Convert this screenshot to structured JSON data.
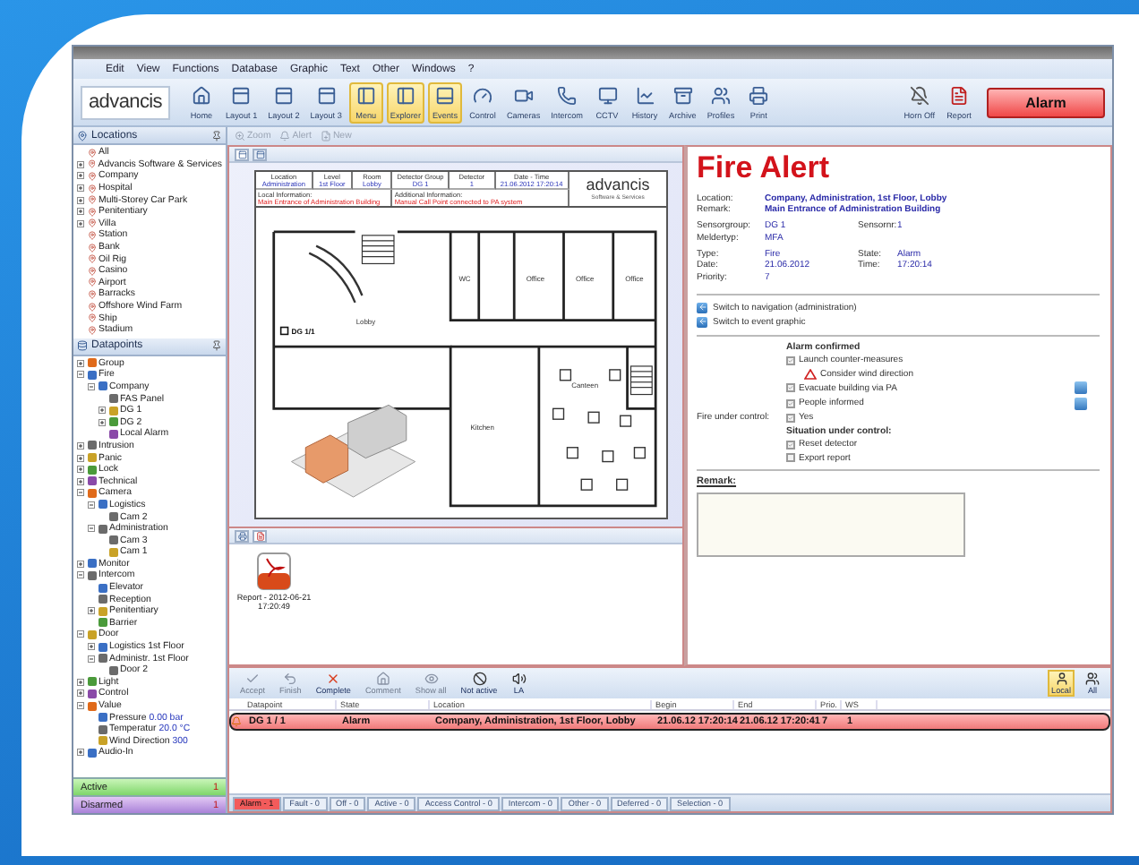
{
  "menu": [
    "Edit",
    "View",
    "Functions",
    "Database",
    "Graphic",
    "Text",
    "Other",
    "Windows",
    "?"
  ],
  "logo": "advancis",
  "ribbon": {
    "buttons": [
      {
        "label": "Home",
        "selected": false
      },
      {
        "label": "Layout 1",
        "selected": false
      },
      {
        "label": "Layout 2",
        "selected": false
      },
      {
        "label": "Layout 3",
        "selected": false
      },
      {
        "label": "Menu",
        "selected": true
      },
      {
        "label": "Explorer",
        "selected": true
      },
      {
        "label": "Events",
        "selected": true
      },
      {
        "label": "Control",
        "selected": false
      },
      {
        "label": "Cameras",
        "selected": false
      },
      {
        "label": "Intercom",
        "selected": false
      },
      {
        "label": "CCTV",
        "selected": false
      },
      {
        "label": "History",
        "selected": false
      },
      {
        "label": "Archive",
        "selected": false
      },
      {
        "label": "Profiles",
        "selected": false
      },
      {
        "label": "Print",
        "selected": false
      }
    ],
    "right_buttons": [
      "Horn Off",
      "Report"
    ],
    "alarm": "Alarm"
  },
  "locations": {
    "title": "Locations",
    "items": [
      {
        "label": "All"
      },
      {
        "label": "Advancis Software & Services",
        "expanded": false
      },
      {
        "label": "Company",
        "expanded": false
      },
      {
        "label": "Hospital",
        "expanded": false
      },
      {
        "label": "Multi-Storey Car Park",
        "expanded": false
      },
      {
        "label": "Penitentiary",
        "expanded": false
      },
      {
        "label": "Villa",
        "expanded": false
      },
      {
        "label": "Station"
      },
      {
        "label": "Bank"
      },
      {
        "label": "Oil Rig"
      },
      {
        "label": "Casino"
      },
      {
        "label": "Airport"
      },
      {
        "label": "Barracks"
      },
      {
        "label": "Offshore Wind Farm"
      },
      {
        "label": "Ship"
      },
      {
        "label": "Stadium"
      }
    ]
  },
  "datapoints": {
    "title": "Datapoints",
    "items": [
      {
        "label": "Group",
        "expanded": false
      },
      {
        "label": "Fire",
        "expanded": true,
        "children": [
          {
            "label": "Company",
            "expanded": true,
            "children": [
              {
                "label": "FAS Panel"
              },
              {
                "label": "DG 1",
                "expanded": false
              },
              {
                "label": "DG 2",
                "expanded": false
              },
              {
                "label": "Local Alarm"
              }
            ]
          }
        ]
      },
      {
        "label": "Intrusion",
        "expanded": false
      },
      {
        "label": "Panic",
        "expanded": false
      },
      {
        "label": "Lock",
        "expanded": false
      },
      {
        "label": "Technical",
        "expanded": false
      },
      {
        "label": "Camera",
        "expanded": true,
        "children": [
          {
            "label": "Logistics",
            "expanded": true,
            "children": [
              {
                "label": "Cam 2"
              }
            ]
          },
          {
            "label": "Administration",
            "expanded": true,
            "children": [
              {
                "label": "Cam 3"
              },
              {
                "label": "Cam 1"
              }
            ]
          }
        ]
      },
      {
        "label": "Monitor",
        "expanded": false
      },
      {
        "label": "Intercom",
        "expanded": true,
        "children": [
          {
            "label": "Elevator"
          },
          {
            "label": "Reception"
          },
          {
            "label": "Penitentiary",
            "expanded": false
          },
          {
            "label": "Barrier"
          }
        ]
      },
      {
        "label": "Door",
        "expanded": true,
        "children": [
          {
            "label": "Logistics 1st Floor",
            "expanded": false
          },
          {
            "label": "Administr. 1st Floor",
            "expanded": true,
            "children": [
              {
                "label": "Door 2"
              }
            ]
          }
        ]
      },
      {
        "label": "Light",
        "expanded": false
      },
      {
        "label": "Control",
        "expanded": false
      },
      {
        "label": "Value",
        "expanded": true,
        "children": [
          {
            "label": "Pressure",
            "value": "0.00 bar"
          },
          {
            "label": "Temperatur",
            "value": "20.0 °C"
          },
          {
            "label": "Wind Direction",
            "value": "300"
          }
        ]
      },
      {
        "label": "Audio-In",
        "expanded": false
      }
    ]
  },
  "summary": [
    {
      "kind": "active",
      "label": "Active",
      "count": "1"
    },
    {
      "kind": "disarmed",
      "label": "Disarmed",
      "count": "1"
    }
  ],
  "graphic_toolbar": [
    {
      "label": "Zoom",
      "disabled": true
    },
    {
      "label": "Alert",
      "disabled": true
    },
    {
      "label": "New",
      "disabled": true
    }
  ],
  "graphic": {
    "cells": [
      {
        "label": "Location",
        "value": "Administration"
      },
      {
        "label": "Level",
        "value": "1st Floor"
      },
      {
        "label": "Room",
        "value": "Lobby"
      },
      {
        "label": "Detector Group",
        "value": "DG 1"
      },
      {
        "label": "Detector",
        "value": "1"
      },
      {
        "label": "Date - Time",
        "value": "21.06.2012 17:20:14"
      }
    ],
    "info": [
      {
        "label": "Local Information:",
        "value": "Main Entrance of Administration Building"
      },
      {
        "label": "Additional Information:",
        "value": "Manual Call Point connected to PA system"
      }
    ],
    "logo": "advancis",
    "tagline": "Software & Services",
    "rooms": [
      "Office",
      "Office",
      "Office",
      "Lobby",
      "Kitchen",
      "Canteen",
      "WC"
    ],
    "marker": "DG 1/1"
  },
  "attachments": [
    "Report - 2012-06-21 17:20:49"
  ],
  "alert": {
    "title": "Fire Alert",
    "groups": [
      {
        "emphasis": true,
        "rows": [
          [
            {
              "label": "Location:",
              "value": "Company, Administration, 1st Floor, Lobby"
            }
          ],
          [
            {
              "label": "Remark:",
              "value": "Main Entrance of Administration Building"
            }
          ]
        ]
      },
      {
        "emphasis": false,
        "rows": [
          [
            {
              "label": "Sensorgroup:",
              "value": "DG 1"
            },
            {
              "label": "Sensornr:",
              "value": "1"
            }
          ],
          [
            {
              "label": "Meldertyp:",
              "value": "MFA"
            }
          ]
        ]
      },
      {
        "emphasis": false,
        "rows": [
          [
            {
              "label": "Type:",
              "value": "Fire"
            },
            {
              "label": "State:",
              "value": "Alarm"
            }
          ],
          [
            {
              "label": "Date:",
              "value": "21.06.2012"
            },
            {
              "label": "Time:",
              "value": "17:20:14"
            }
          ],
          [
            {
              "label": "Priority:",
              "value": "7"
            }
          ]
        ]
      }
    ],
    "links": [
      "Switch to navigation (administration)",
      "Switch to event graphic"
    ],
    "checklist": [
      {
        "kind": "heading",
        "label": "Alarm confirmed"
      },
      {
        "kind": "check",
        "label": "Launch counter-measures",
        "checked": true
      },
      {
        "kind": "warning",
        "label": "Consider wind direction"
      },
      {
        "kind": "check",
        "label": "Evacuate building via PA",
        "checked": true,
        "action": true
      },
      {
        "kind": "check",
        "label": "People informed",
        "checked": true,
        "action": true
      },
      {
        "kind": "check",
        "side_label": "Fire under control:",
        "label": "Yes",
        "checked": true
      },
      {
        "kind": "heading",
        "label": "Situation under control:"
      },
      {
        "kind": "check",
        "label": "Reset detector",
        "checked": true
      },
      {
        "kind": "check",
        "label": "Export report",
        "checked": false
      }
    ],
    "remark_label": "Remark:"
  },
  "event_toolbar": {
    "buttons": [
      {
        "label": "Accept",
        "disabled": true
      },
      {
        "label": "Finish",
        "disabled": true
      },
      {
        "label": "Complete",
        "disabled": false
      },
      {
        "label": "Comment",
        "disabled": true
      },
      {
        "label": "Show all",
        "disabled": true
      },
      {
        "label": "Not active",
        "disabled": false
      },
      {
        "label": "LA",
        "disabled": false
      }
    ],
    "views": [
      {
        "label": "Local",
        "selected": true
      },
      {
        "label": "All",
        "selected": false
      }
    ]
  },
  "events": {
    "columns": [
      "Datapoint",
      "State",
      "Location",
      "Begin",
      "End",
      "Prio.",
      "WS"
    ],
    "rows": [
      {
        "selected": true,
        "cells": [
          "DG 1 / 1",
          "Alarm",
          "Company, Administration, 1st Floor, Lobby",
          "21.06.12  17:20:14",
          "21.06.12  17:20:41",
          "7",
          "1"
        ]
      }
    ]
  },
  "event_tabs": [
    {
      "label": "Alarm - 1",
      "selected": true
    },
    {
      "label": "Fault - 0",
      "selected": false
    },
    {
      "label": "Off - 0",
      "selected": false
    },
    {
      "label": "Active - 0",
      "selected": false
    },
    {
      "label": "Access Control - 0",
      "selected": false
    },
    {
      "label": "Intercom - 0",
      "selected": false
    },
    {
      "label": "Other - 0",
      "selected": false
    },
    {
      "label": "Deferred - 0",
      "selected": false
    },
    {
      "label": "Selection - 0",
      "selected": false
    }
  ]
}
